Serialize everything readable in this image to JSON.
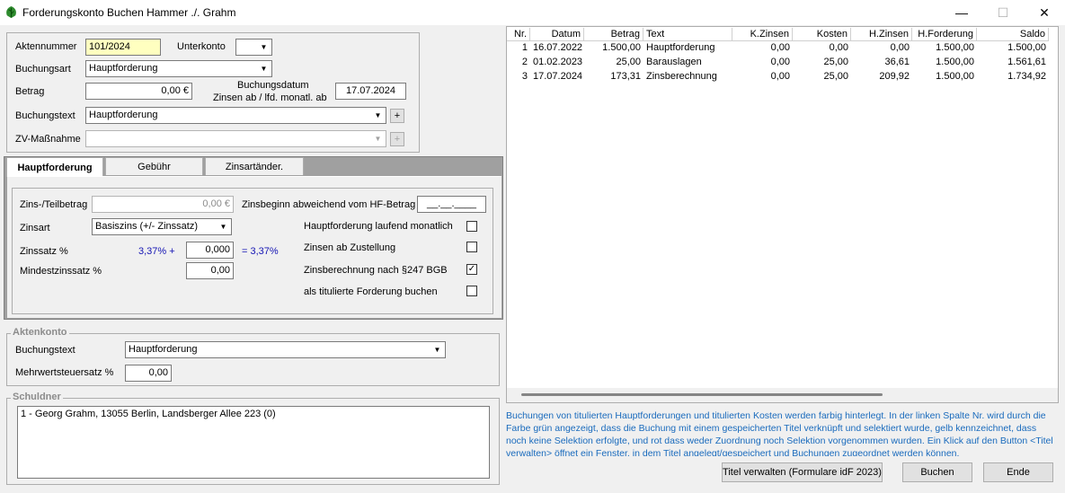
{
  "window": {
    "title": "Forderungskonto Buchen Hammer ./. Grahm",
    "minimize": "—",
    "maximize": "☐",
    "close": "✕"
  },
  "top": {
    "aktennummer_label": "Aktennummer",
    "aktennummer_value": "101/2024",
    "unterkonto_label": "Unterkonto",
    "unterkonto_value": "",
    "buchungsart_label": "Buchungsart",
    "buchungsart_value": "Hauptforderung",
    "betrag_label": "Betrag",
    "betrag_value": "0,00 €",
    "buchungsdatum_label": "Buchungsdatum",
    "zinsen_label": "Zinsen ab / lfd. monatl. ab",
    "buchungsdatum_value": "17.07.2024",
    "buchungstext_label": "Buchungstext",
    "buchungstext_value": "Hauptforderung",
    "zv_label": "ZV-Maßnahme",
    "zv_value": "",
    "add": "+"
  },
  "tabs": [
    "Hauptforderung",
    "Gebühr",
    "Zinsartänder."
  ],
  "hf": {
    "zins_teilbetrag_label": "Zins-/Teilbetrag",
    "zins_teilbetrag_value": "0,00 €",
    "zinsbeginn_label": "Zinsbeginn abweichend vom HF-Betrag",
    "zinsbeginn_value": "__.__.____",
    "zinsart_label": "Zinsart",
    "zinsart_value": "Basiszins (+/- Zinssatz)",
    "zinssatz_label": "Zinssatz %",
    "zinssatz_base": "3,37% +",
    "zinssatz_value": "0,000",
    "zinssatz_result": "= 3,37%",
    "mindest_label": "Mindestzinssatz %",
    "mindest_value": "0,00",
    "cb1": "Hauptforderung laufend monatlich",
    "cb2": "Zinsen ab Zustellung",
    "cb3": "Zinsberechnung nach §247 BGB",
    "cb4": "als titulierte Forderung buchen",
    "check": "✓"
  },
  "aktenkonto": {
    "title": "Aktenkonto",
    "buchungstext_label": "Buchungstext",
    "buchungstext_value": "Hauptforderung",
    "mwst_label": "Mehrwertsteuersatz %",
    "mwst_value": "0,00"
  },
  "schuldner": {
    "title": "Schuldner",
    "entry": "1 - Georg Grahm, 13055 Berlin, Landsberger Allee 223 (0)"
  },
  "table": {
    "headers": [
      "Nr.",
      "Datum",
      "Betrag",
      "Text",
      "K.Zinsen",
      "Kosten",
      "H.Zinsen",
      "H.Forderung",
      "Saldo"
    ],
    "rows": [
      [
        "1",
        "16.07.2022",
        "1.500,00",
        "Hauptforderung",
        "0,00",
        "0,00",
        "0,00",
        "1.500,00",
        "1.500,00"
      ],
      [
        "2",
        "01.02.2023",
        "25,00",
        "Barauslagen",
        "0,00",
        "25,00",
        "36,61",
        "1.500,00",
        "1.561,61"
      ],
      [
        "3",
        "17.07.2024",
        "173,31",
        "Zinsberechnung",
        "0,00",
        "25,00",
        "209,92",
        "1.500,00",
        "1.734,92"
      ]
    ]
  },
  "info": "Buchungen von titulierten Hauptforderungen und titulierten Kosten werden farbig hinterlegt. In der linken Spalte Nr. wird durch die Farbe grün angezeigt, dass die Buchung mit einem gespeicherten Titel verknüpft und selektiert wurde, gelb kennzeichnet, dass noch keine Selektion erfolgte, und rot dass weder Zuordnung noch Selektion vorgenommen wurden. Ein Klick auf den Button <Titel verwalten> öffnet ein Fenster, in dem Titel angelegt/gespeichert und Buchungen zugeordnet werden können.",
  "buttons": {
    "titel": "Titel verwalten (Formulare idF 2023)",
    "buchen": "Buchen",
    "ende": "Ende"
  }
}
